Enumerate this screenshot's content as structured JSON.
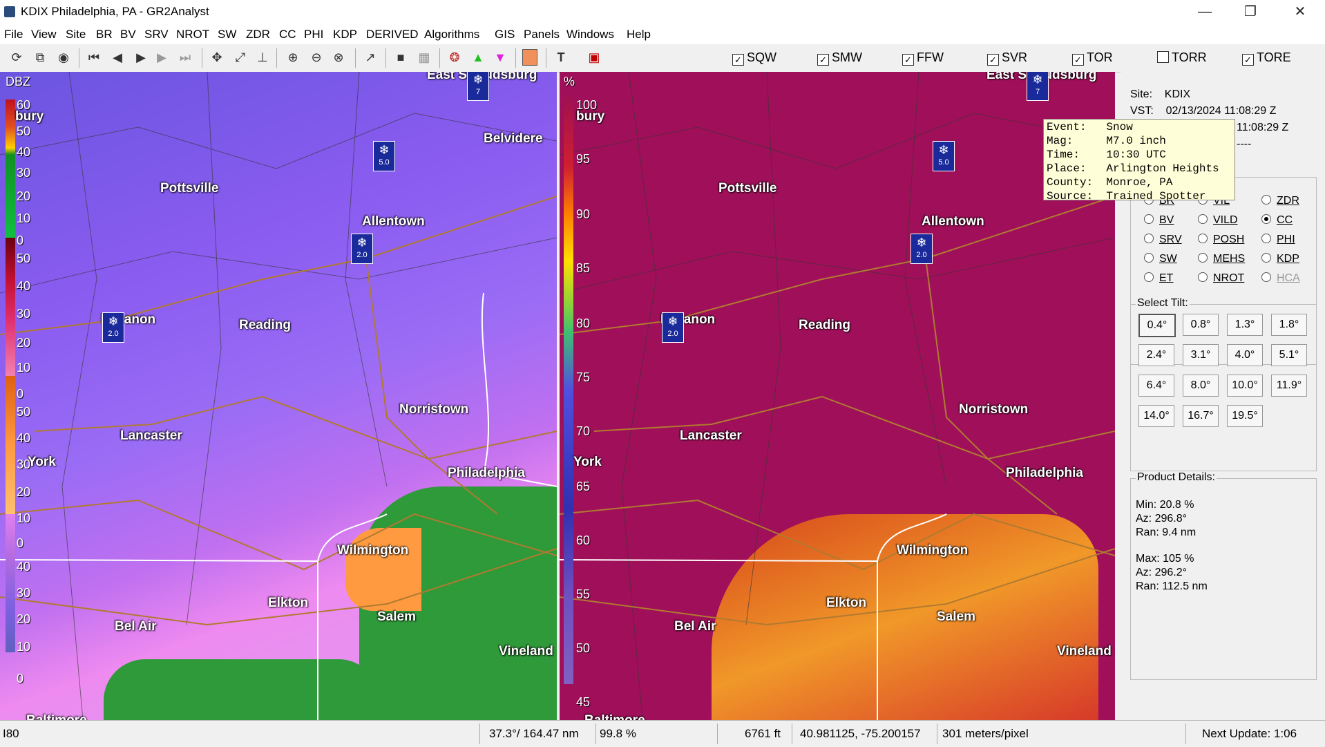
{
  "window": {
    "title": "KDIX Philadelphia, PA - GR2Analyst",
    "minimize": "—",
    "restore": "❐",
    "close": "✕"
  },
  "menu": [
    "File",
    "View",
    "Site",
    "BR",
    "BV",
    "SRV",
    "NROT",
    "SW",
    "ZDR",
    "CC",
    "PHI",
    "KDP",
    "DERIVED",
    "Algorithms",
    "GIS",
    "Panels",
    "Windows",
    "Help"
  ],
  "warnings": [
    {
      "label": "SQW",
      "checked": true
    },
    {
      "label": "SMW",
      "checked": true
    },
    {
      "label": "FFW",
      "checked": true
    },
    {
      "label": "SVR",
      "checked": true
    },
    {
      "label": "TOR",
      "checked": true
    },
    {
      "label": "TORR",
      "checked": false
    },
    {
      "label": "TORE",
      "checked": true
    }
  ],
  "left_panel": {
    "unit": "DBZ",
    "scale_labels": [
      "60",
      "50",
      "40",
      "30",
      "20",
      "10",
      "0",
      "50",
      "40",
      "30",
      "20",
      "10",
      "0",
      "50",
      "40",
      "30",
      "20",
      "10",
      "0",
      "40",
      "30",
      "20",
      "10",
      "0"
    ],
    "scale_colors": {
      "band1": "#18a030",
      "band2": "#c01030",
      "band3": "#ff9a40",
      "band4": "#b06ae0"
    }
  },
  "right_panel": {
    "unit": "%",
    "scale_labels": [
      "100",
      "95",
      "90",
      "85",
      "80",
      "75",
      "70",
      "65",
      "60",
      "55",
      "50",
      "45"
    ]
  },
  "cities": {
    "east_stroudsburg": "East Stroudsburg",
    "belvidere": "Belvidere",
    "pottsville": "Pottsville",
    "allentown": "Allentown",
    "lebanon": "Lebanon",
    "reading": "Reading",
    "norristown": "Norristown",
    "lancaster": "Lancaster",
    "york": "York",
    "philadelphia": "Philadelphia",
    "wilmington": "Wilmington",
    "elkton": "Elkton",
    "bel_air": "Bel Air",
    "salem": "Salem",
    "vineland": "Vineland",
    "baltimore": "Baltimore",
    "bury": "bury"
  },
  "snow_reports": [
    {
      "value": "7"
    },
    {
      "value": "5.0"
    },
    {
      "value": "2.0"
    },
    {
      "value": "2.0"
    }
  ],
  "site_info": {
    "site_label": "Site:",
    "site": "KDIX",
    "vst_label": "VST:",
    "vst": "02/13/2024  11:08:29 Z",
    "line2_tail": "11:08:29 Z",
    "line3_tail": "----"
  },
  "tooltip": {
    "event": "Event:   Snow",
    "mag": "Mag:     M7.0 inch",
    "time": "Time:    10:30 UTC",
    "place": "Place:   Arlington Heights",
    "county": "County:  Monroe, PA",
    "source": "Source:  Trained Spotter"
  },
  "products": [
    {
      "label": "BR",
      "selected": false
    },
    {
      "label": "VIL",
      "selected": false
    },
    {
      "label": "ZDR",
      "selected": false
    },
    {
      "label": "BV",
      "selected": false
    },
    {
      "label": "VILD",
      "selected": false
    },
    {
      "label": "CC",
      "selected": true
    },
    {
      "label": "SRV",
      "selected": false
    },
    {
      "label": "POSH",
      "selected": false
    },
    {
      "label": "PHI",
      "selected": false
    },
    {
      "label": "SW",
      "selected": false
    },
    {
      "label": "MEHS",
      "selected": false
    },
    {
      "label": "KDP",
      "selected": false
    },
    {
      "label": "ET",
      "selected": false
    },
    {
      "label": "NROT",
      "selected": false
    },
    {
      "label": "HCA",
      "selected": false
    }
  ],
  "tilt": {
    "title": "Select Tilt:",
    "values": [
      "0.4°",
      "0.8°",
      "1.3°",
      "1.8°",
      "2.4°",
      "3.1°",
      "4.0°",
      "5.1°",
      "6.4°",
      "8.0°",
      "10.0°",
      "11.9°",
      "14.0°",
      "16.7°",
      "19.5°"
    ],
    "selected": "0.4°"
  },
  "product_details": {
    "title": "Product Details:",
    "min": "Min:  20.8 %",
    "min_az": "Az:   296.8°",
    "min_ran": "Ran:  9.4 nm",
    "max": "Max:  105 %",
    "max_az": "Az:   296.2°",
    "max_ran": "Ran:  112.5 nm"
  },
  "status": {
    "layer": "I80",
    "azran": "37.3°/ 164.47 nm",
    "value": "99.8 %",
    "height": "6761 ft",
    "latlon": "40.981125, -75.200157",
    "resolution": "301 meters/pixel",
    "next_update": "Next Update: 1:06"
  }
}
